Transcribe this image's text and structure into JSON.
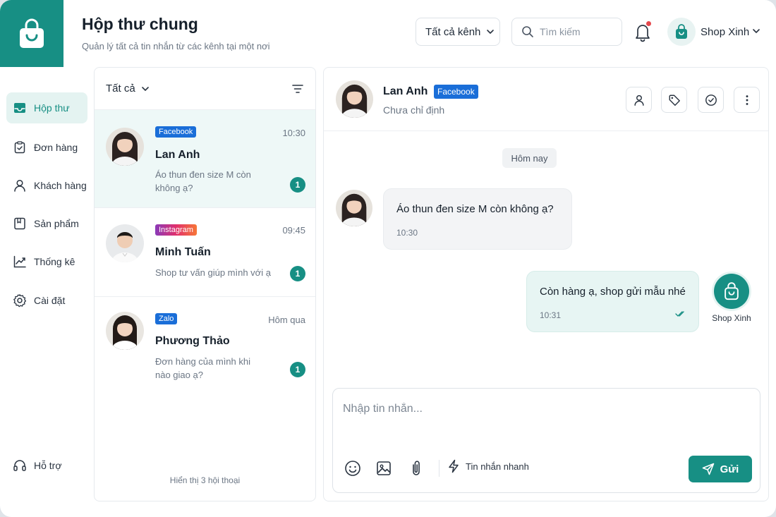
{
  "header": {
    "title": "Hộp thư chung",
    "subtitle": "Quản lý tất cả tin nhắn từ các kênh tại một nơi",
    "channel_filter": "Tất cả kênh",
    "search_placeholder": "Tìm kiếm",
    "has_notification": true,
    "shop_name": "Shop Xinh"
  },
  "sidebar": {
    "items": [
      {
        "label": "Hộp thư",
        "icon": "inbox-icon",
        "active": true
      },
      {
        "label": "Đơn hàng",
        "icon": "clipboard-check-icon"
      },
      {
        "label": "Khách hàng",
        "icon": "user-icon"
      },
      {
        "label": "Sản phẩm",
        "icon": "book-icon"
      },
      {
        "label": "Thống kê",
        "icon": "chart-line-icon"
      },
      {
        "label": "Cài đặt",
        "icon": "gear-icon"
      }
    ],
    "support_label": "Hỗ trợ"
  },
  "conversations": {
    "filter_label": "Tất cả",
    "items": [
      {
        "channel": "Facebook",
        "name": "Lan Anh",
        "time": "10:30",
        "preview": "Áo thun đen size M còn không ạ?",
        "unread": "1",
        "active": true
      },
      {
        "channel": "Instagram",
        "name": "Minh Tuấn",
        "time": "09:45",
        "preview": "Shop tư vấn giúp mình với ạ",
        "unread": "1"
      },
      {
        "channel": "Zalo",
        "name": "Phương Thảo",
        "time": "Hôm qua",
        "preview": "Đơn hàng của mình khi nào giao ạ?",
        "unread": "1"
      }
    ],
    "footer": "Hiển thị 3 hội thoại"
  },
  "chat": {
    "contact_name": "Lan Anh",
    "contact_channel": "Facebook",
    "assignment": "Chưa chỉ định",
    "day_label": "Hôm nay",
    "messages": [
      {
        "direction": "in",
        "text": "Áo thun đen size M còn không ạ?",
        "time": "10:30"
      },
      {
        "direction": "out",
        "text": "Còn hàng ạ, shop gửi mẫu nhé",
        "time": "10:31",
        "sender": "Shop Xinh",
        "status": "read"
      }
    ],
    "composer_placeholder": "Nhập tin nhắn...",
    "quick_reply_label": "Tin nhắn nhanh",
    "send_label": "Gửi"
  },
  "colors": {
    "brand": "#178f84",
    "facebook": "#1a6ed8",
    "notification": "#e5484d"
  }
}
